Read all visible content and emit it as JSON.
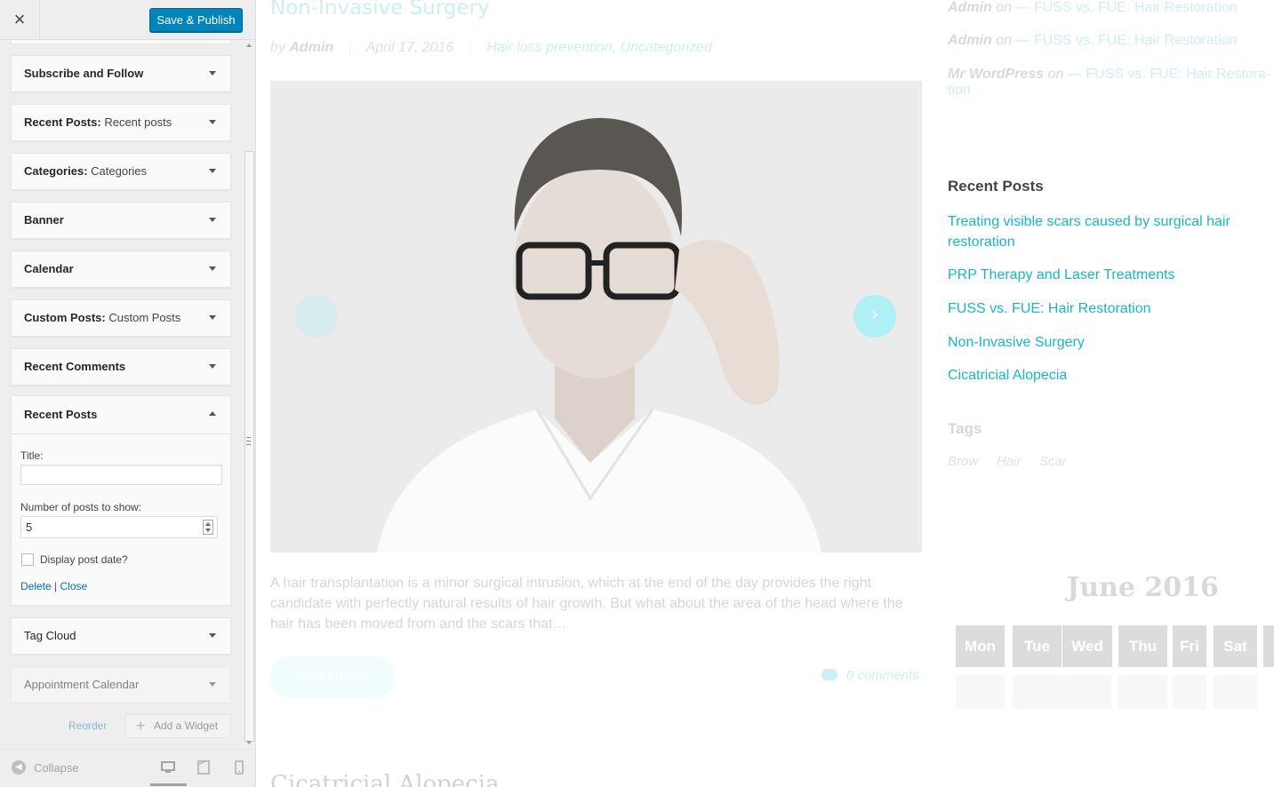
{
  "customizer": {
    "close_label": "×",
    "save_publish_label": "Save & Publish",
    "widgets": [
      {
        "title": "Subscribe and Follow",
        "instance": ""
      },
      {
        "title": "Recent Posts:",
        "instance": "Recent posts"
      },
      {
        "title": "Categories:",
        "instance": "Categories"
      },
      {
        "title": "Banner",
        "instance": ""
      },
      {
        "title": "Calendar",
        "instance": ""
      },
      {
        "title": "Custom Posts:",
        "instance": "Custom Posts"
      },
      {
        "title": "Recent Comments",
        "instance": ""
      }
    ],
    "open_widget": {
      "title": "Recent Posts",
      "title_field_label": "Title:",
      "title_field_value": "",
      "number_label": "Number of posts to show:",
      "number_value": "5",
      "show_date_label": "Display post date?",
      "show_date_checked": false,
      "delete_label": "Delete",
      "link_sep": "|",
      "close_label": "Close"
    },
    "widgets_after": [
      {
        "title": "Tag Cloud"
      },
      {
        "title": "Appointment Calendar"
      }
    ],
    "reorder_label": "Reorder",
    "add_widget_label": "Add a Widget",
    "collapse_label": "Collapse"
  },
  "preview": {
    "post_title": "Non-Invasive Surgery",
    "meta_by": "by",
    "meta_author": "Admin",
    "meta_date": "April 17, 2016",
    "meta_categories": "Hair loss prevention, Uncategorized",
    "excerpt": "A hair transplantation is a minor surgical intrusion, which at the end of the day provides the right candidate with perfectly natural results of hair growth. But what about  the area of the head where the hair has been moved from and the scars that…",
    "read_more_label": "Read more",
    "comments_label": "0 comments",
    "next_post_title": "Cicatricial Alopecia",
    "recent_comments": [
      {
        "author": "Admin",
        "on": "on",
        "post": "— FUSS vs. FUE: Hair Restoration"
      },
      {
        "author": "Admin",
        "on": "on",
        "post": "— FUSS vs. FUE: Hair Restoration"
      },
      {
        "author": "Mr WordPress",
        "on": "on",
        "post": "— FUSS vs. FUE: Hair Restora-",
        "post_cont": "tion"
      }
    ],
    "recent_posts_heading": "Recent Posts",
    "recent_posts": [
      {
        "line1": "Treating visible scars caused by surgical hair",
        "line2": "restoration"
      },
      {
        "line1": "PRP Therapy and Laser Treatments",
        "line2": ""
      },
      {
        "line1": "FUSS vs. FUE: Hair Restoration",
        "line2": ""
      },
      {
        "line1": "Non-Invasive Surgery",
        "line2": ""
      },
      {
        "line1": "Cicatricial Alopecia",
        "line2": ""
      }
    ],
    "tags_heading": "Tags",
    "tags": [
      "Brow",
      "Hair",
      "Scar"
    ],
    "calendar_title": "June 2016",
    "calendar_days": [
      "Mon",
      "Tue",
      "Wed",
      "Thu",
      "Fri",
      "Sat"
    ]
  },
  "colors": {
    "accent": "#1ab6c6",
    "publish_button": "#0085ba",
    "link": "#0073aa"
  }
}
